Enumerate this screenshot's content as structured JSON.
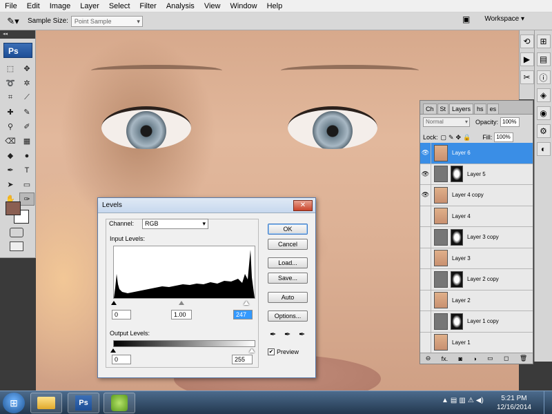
{
  "menu": [
    "File",
    "Edit",
    "Image",
    "Layer",
    "Select",
    "Filter",
    "Analysis",
    "View",
    "Window",
    "Help"
  ],
  "options_bar": {
    "sample_size_label": "Sample Size:",
    "sample_size_value": "Point Sample",
    "workspace_label": "Workspace ▾"
  },
  "toolbox": {
    "logo": "Ps",
    "foreground_color": "#8a5f52",
    "background_color": "#ffffff"
  },
  "layers_panel": {
    "tabs": [
      "Ch",
      "St",
      "Layers",
      "hs",
      "es"
    ],
    "active_tab": "Layers",
    "blend_mode": "Normal",
    "opacity_label": "Opacity:",
    "opacity_value": "100%",
    "lock_label": "Lock:",
    "fill_label": "Fill:",
    "fill_value": "100%",
    "layers": [
      {
        "name": "Layer 6",
        "visible": true,
        "selected": true,
        "mask": false
      },
      {
        "name": "Layer 5",
        "visible": true,
        "selected": false,
        "mask": true
      },
      {
        "name": "Layer 4 copy",
        "visible": true,
        "selected": false,
        "mask": false
      },
      {
        "name": "Layer 4",
        "visible": false,
        "selected": false,
        "mask": false
      },
      {
        "name": "Layer 3 copy",
        "visible": false,
        "selected": false,
        "mask": true
      },
      {
        "name": "Layer 3",
        "visible": false,
        "selected": false,
        "mask": false
      },
      {
        "name": "Layer 2 copy",
        "visible": false,
        "selected": false,
        "mask": true
      },
      {
        "name": "Layer 2",
        "visible": false,
        "selected": false,
        "mask": false
      },
      {
        "name": "Layer 1 copy",
        "visible": false,
        "selected": false,
        "mask": true
      },
      {
        "name": "Layer 1",
        "visible": false,
        "selected": false,
        "mask": false
      }
    ],
    "footer_icons": [
      "link-icon",
      "fx-icon",
      "mask-icon",
      "adjustment-icon",
      "group-icon",
      "new-layer-icon",
      "trash-icon"
    ]
  },
  "levels_dialog": {
    "title": "Levels",
    "channel_label": "Channel:",
    "channel_value": "RGB",
    "input_levels_label": "Input Levels:",
    "input_black": "0",
    "input_gamma": "1.00",
    "input_white": "247",
    "output_levels_label": "Output Levels:",
    "output_black": "0",
    "output_white": "255",
    "buttons": {
      "ok": "OK",
      "cancel": "Cancel",
      "load": "Load...",
      "save": "Save...",
      "auto": "Auto",
      "options": "Options..."
    },
    "preview_label": "Preview",
    "preview_checked": true
  },
  "taskbar": {
    "time": "5:21 PM",
    "date": "12/16/2014",
    "apps": [
      "explorer",
      "photoshop",
      "app-green"
    ]
  }
}
